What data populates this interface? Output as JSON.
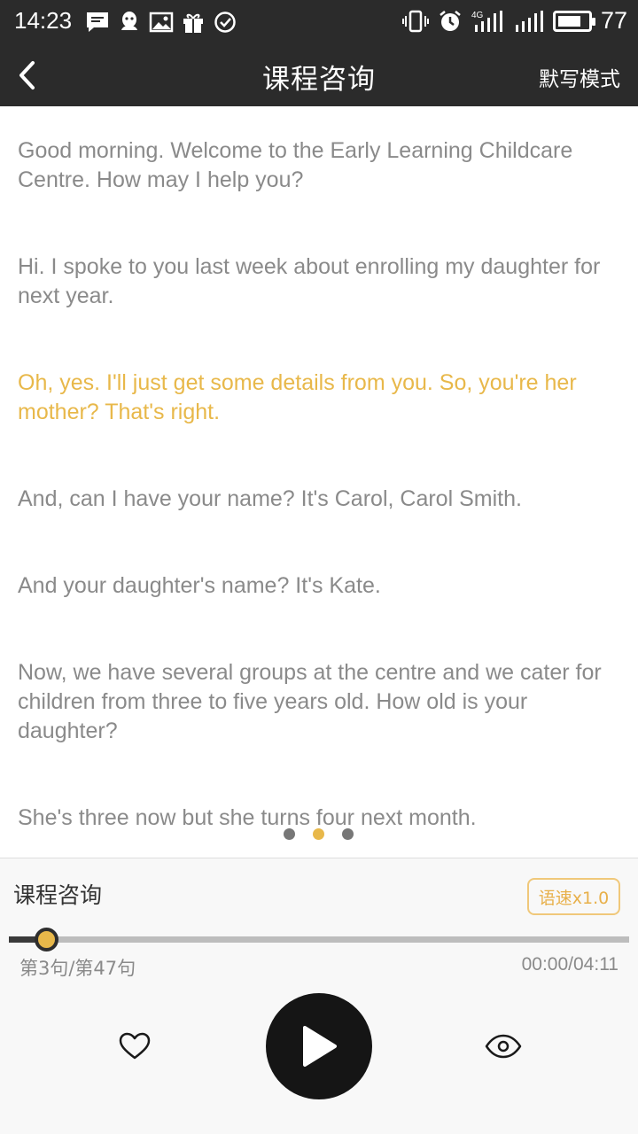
{
  "status_bar": {
    "time": "14:23",
    "network": "4G",
    "battery_level": "77",
    "battery_fraction": 0.77,
    "left_icons": [
      "message-icon",
      "qq-icon",
      "image-icon",
      "gift-icon",
      "check-circle-icon"
    ],
    "right_icons": [
      "vibrate-icon",
      "alarm-icon",
      "signal-4g-icon",
      "signal-icon",
      "battery-icon"
    ]
  },
  "toolbar": {
    "title": "课程咨询",
    "dictation_mode": "默写模式"
  },
  "transcript": {
    "sentences": [
      "Good morning. Welcome to the Early Learning Childcare Centre. How may I help you?",
      "Hi. I spoke to you last week about enrolling my daughter for next year.",
      "Oh, yes. I'll just get some details from you. So, you're her mother? That's right.",
      "And, can I have your name? It's Carol, Carol Smith.",
      "And your daughter's name? It's Kate.",
      "Now, we have several groups at the centre and we cater for children from three to five years old. How old is your daughter?",
      "She's three now but she turns four next month."
    ],
    "active_index": 2,
    "pages": 3,
    "current_page": 1
  },
  "player": {
    "title": "课程咨询",
    "speed": "语速x1.0",
    "counter": "第3句/第47句",
    "time": "00:00/04:11",
    "progress": 0.046
  },
  "colors": {
    "accent": "#e8b84a",
    "header_bg": "#2b2b2b",
    "text_gray": "#8a8a8a"
  }
}
